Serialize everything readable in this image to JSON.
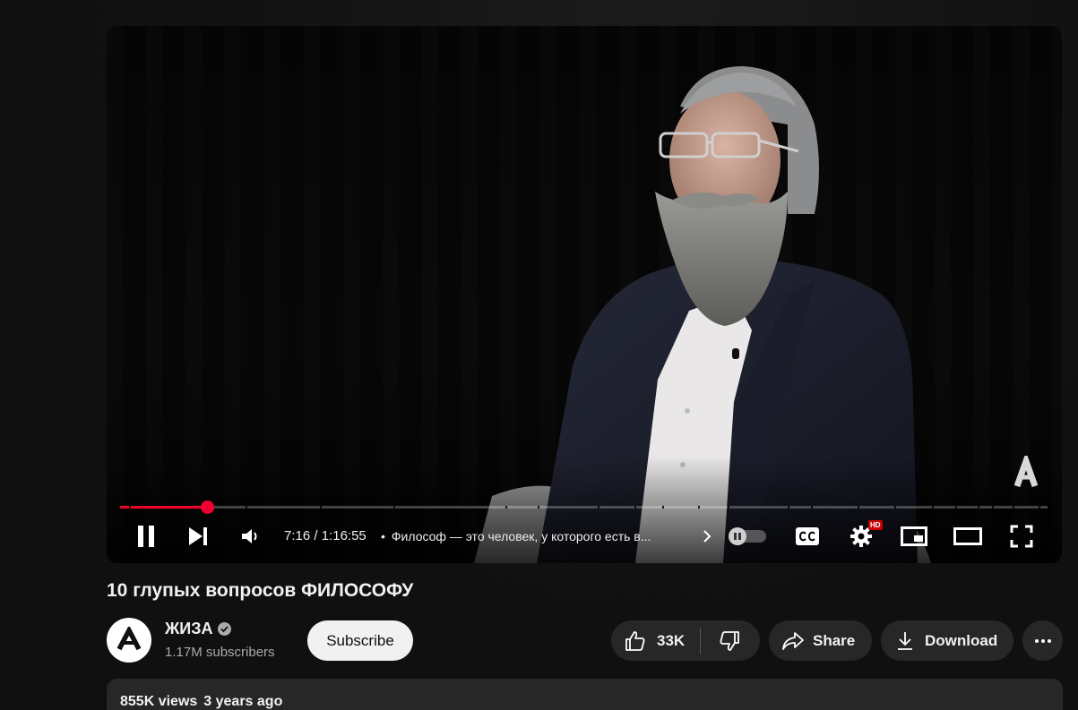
{
  "video": {
    "current_time": "7:16",
    "duration": "1:16:55",
    "separator": " / ",
    "progress": 0.094,
    "chapter_title": "Философ — это человек, у которого есть в...",
    "chapter_dot": "•",
    "hd_badge": "HD",
    "accent_color": "#f0002c"
  },
  "title": "10 глупых вопросов ФИЛОСОФУ",
  "channel": {
    "name": "ЖИЗА",
    "subscribers": "1.17M subscribers",
    "avatar_icon": "zhiza-logo-icon",
    "verified_icon": "verified-check-icon"
  },
  "actions": {
    "subscribe": "Subscribe",
    "likes": "33K",
    "share": "Share",
    "download": "Download"
  },
  "description": {
    "views": "855K views",
    "date": "3 years ago"
  }
}
